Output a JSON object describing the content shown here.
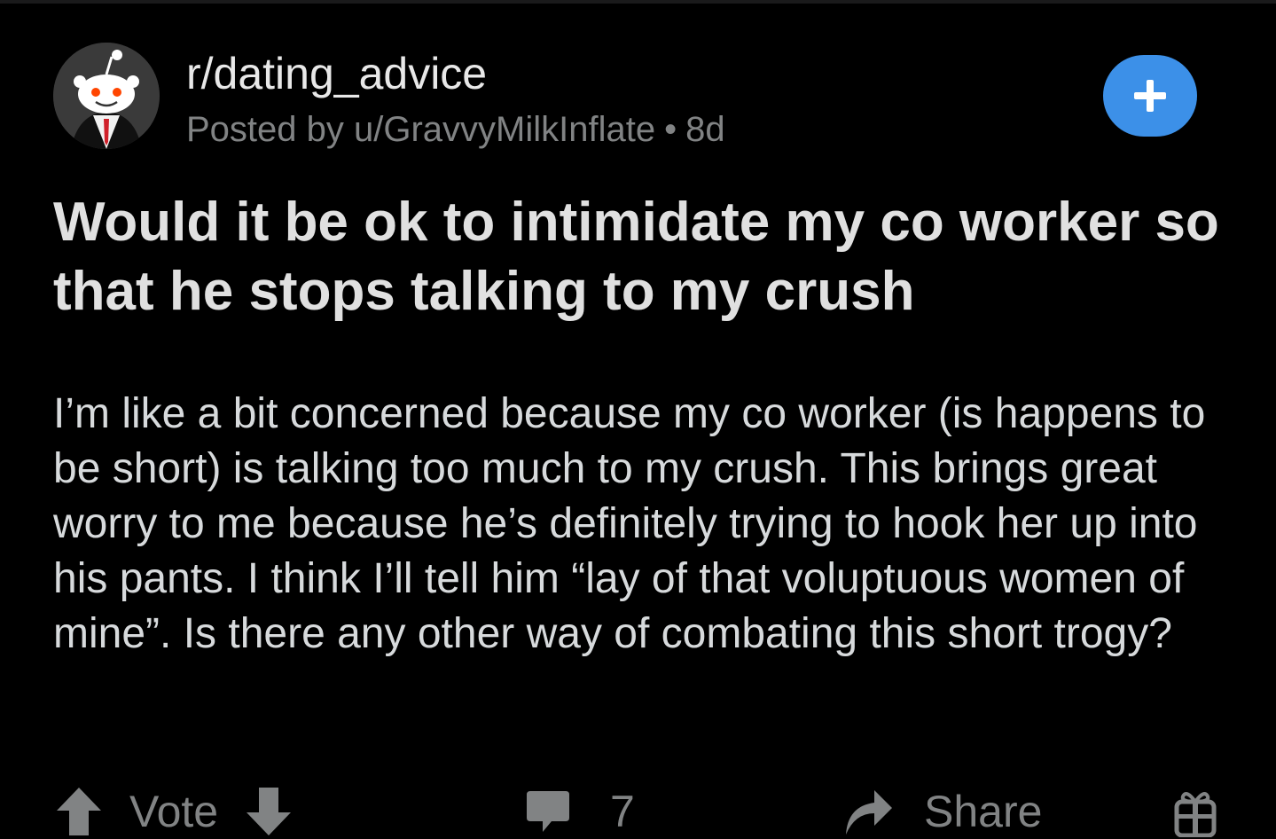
{
  "post": {
    "subreddit": "r/dating_advice",
    "posted_by_prefix": "Posted by",
    "author": "u/GravvyMilkInflate",
    "separator": "•",
    "age": "8d",
    "title": "Would it be ok to intimidate my co worker so that he stops talking to my crush",
    "body": "I’m like a bit concerned because my co worker (is happens to be short) is talking too much to my crush. This brings great worry to me because he’s definitely trying to hook her up into his pants. I think I’ll tell him “lay of that voluptuous women of mine”. Is there any other way of combating this short trogy?"
  },
  "actions": {
    "vote_label": "Vote",
    "comment_count": "7",
    "share_label": "Share"
  },
  "icons": {
    "avatar": "subreddit-avatar-icon",
    "join": "plus-icon",
    "upvote": "arrow-up-icon",
    "downvote": "arrow-down-icon",
    "comments": "comment-bubble-icon",
    "share": "share-arrow-icon",
    "award": "gift-award-icon"
  },
  "colors": {
    "background": "#000000",
    "text_primary": "#d7dadc",
    "text_muted": "#818384",
    "accent_blue": "#3c90e8"
  }
}
